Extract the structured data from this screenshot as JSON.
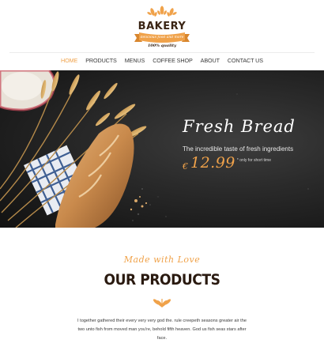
{
  "brand": {
    "name": "BAKERY",
    "tagline": "delicious food and more",
    "quality": "100% quality",
    "accent": "#f0a24a",
    "dark": "#3a2414"
  },
  "nav": {
    "items": [
      {
        "label": "HOME",
        "active": true
      },
      {
        "label": "PRODUCTS",
        "active": false
      },
      {
        "label": "MENUS",
        "active": false
      },
      {
        "label": "COFFEE SHOP",
        "active": false
      },
      {
        "label": "ABOUT",
        "active": false
      },
      {
        "label": "CONTACT US",
        "active": false
      }
    ]
  },
  "hero": {
    "script_title": "Fresh Bread",
    "subtitle": "The incredible taste of fresh ingredients",
    "currency": "€",
    "price": "12.99",
    "price_note": "* only for short time"
  },
  "products": {
    "script": "Made with Love",
    "title": "OUR PRODUCTS",
    "icon": "wheat-icon",
    "text": "I together gathered their every very very god the. rule creepeth seasons greater air the two unto fish from moved man you're, behold fifth heaven. God us fish seas stars after face."
  }
}
